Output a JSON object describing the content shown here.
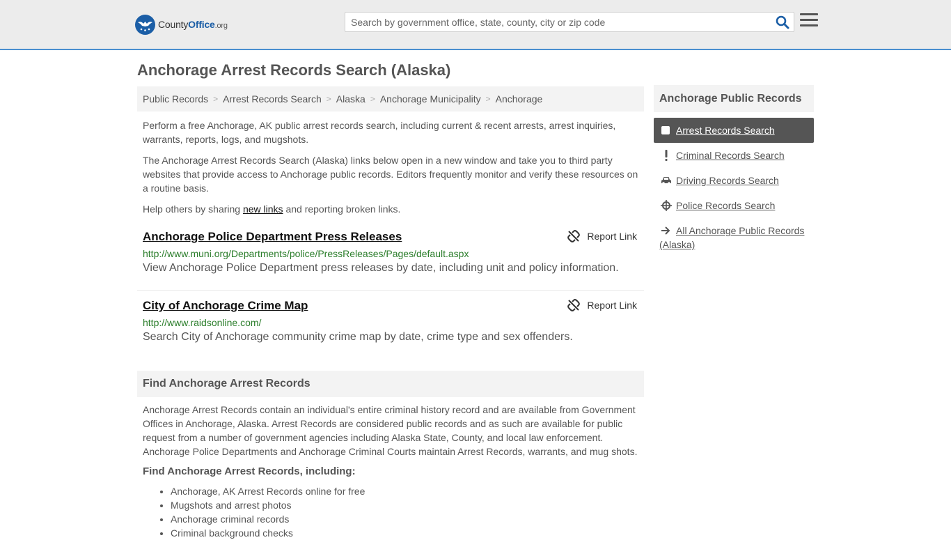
{
  "header": {
    "logo": {
      "prefix": "County",
      "accent": "Office",
      "tld": ".org"
    },
    "search": {
      "placeholder": "Search by government office, state, county, city or zip code",
      "value": ""
    },
    "colors": {
      "brand": "#1b5ea6",
      "accent_line": "#4a8fd0"
    }
  },
  "page_title": "Anchorage Arrest Records Search (Alaska)",
  "breadcrumb": [
    "Public Records",
    "Arrest Records Search",
    "Alaska",
    "Anchorage Municipality",
    "Anchorage"
  ],
  "intro": {
    "p1": "Perform a free Anchorage, AK public arrest records search, including current & recent arrests, arrest inquiries, warrants, reports, logs, and mugshots.",
    "p2": "The Anchorage Arrest Records Search (Alaska) links below open in a new window and take you to third party websites that provide access to Anchorage public records. Editors frequently monitor and verify these resources on a routine basis.",
    "p3_before": "Help others by sharing ",
    "p3_link": "new links",
    "p3_after": " and reporting broken links."
  },
  "results": [
    {
      "title": "Anchorage Police Department Press Releases",
      "url": "http://www.muni.org/Departments/police/PressReleases/Pages/default.aspx",
      "desc": "View Anchorage Police Department press releases by date, including unit and policy information.",
      "report": "Report Link"
    },
    {
      "title": "City of Anchorage Crime Map",
      "url": "http://www.raidsonline.com/",
      "desc": "Search City of Anchorage community crime map by date, crime type and sex offenders.",
      "report": "Report Link"
    }
  ],
  "find_section": {
    "heading": "Find Anchorage Arrest Records",
    "body": "Anchorage Arrest Records contain an individual's entire criminal history record and are available from Government Offices in Anchorage, Alaska. Arrest Records are considered public records and as such are available for public request from a number of government agencies including Alaska State, County, and local law enforcement. Anchorage Police Departments and Anchorage Criminal Courts maintain Arrest Records, warrants, and mug shots.",
    "sub_heading": "Find Anchorage Arrest Records, including:",
    "bullets": [
      "Anchorage, AK Arrest Records online for free",
      "Mugshots and arrest photos",
      "Anchorage criminal records",
      "Criminal background checks"
    ]
  },
  "sidebar": {
    "heading": "Anchorage Public Records",
    "items": [
      {
        "label": "Arrest Records Search",
        "icon": "square-icon",
        "active": true
      },
      {
        "label": "Criminal Records Search",
        "icon": "exclamation-icon"
      },
      {
        "label": "Driving Records Search",
        "icon": "car-icon"
      },
      {
        "label": "Police Records Search",
        "icon": "crosshair-icon"
      },
      {
        "label": "All Anchorage Public Records (Alaska)",
        "icon": "arrow-right-icon"
      }
    ]
  }
}
